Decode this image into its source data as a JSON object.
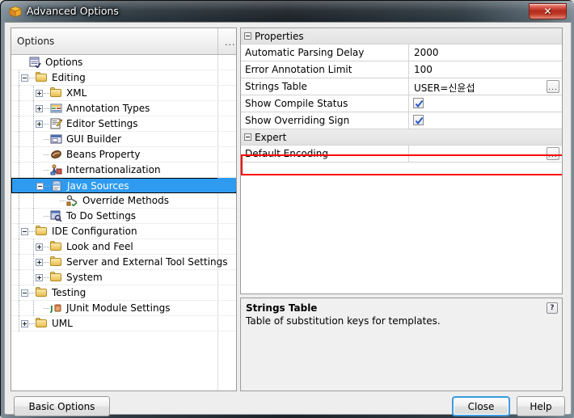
{
  "window": {
    "title": "Advanced Options",
    "icon": "netbeans-cube-icon",
    "close_label": "✕"
  },
  "tree": {
    "header_label": "Options",
    "header_more": "...",
    "items": [
      {
        "label": "Options",
        "depth": 0,
        "icon": "options-list-icon",
        "expander": "none"
      },
      {
        "label": "Editing",
        "depth": 1,
        "icon": "folder-icon",
        "expander": "minus"
      },
      {
        "label": "XML",
        "depth": 2,
        "icon": "folder-icon",
        "expander": "plus"
      },
      {
        "label": "Annotation Types",
        "depth": 2,
        "icon": "annotation-types-icon",
        "expander": "plus"
      },
      {
        "label": "Editor Settings",
        "depth": 2,
        "icon": "editor-settings-icon",
        "expander": "plus"
      },
      {
        "label": "GUI Builder",
        "depth": 2,
        "icon": "gui-builder-icon",
        "expander": "none"
      },
      {
        "label": "Beans Property",
        "depth": 2,
        "icon": "beans-property-icon",
        "expander": "none"
      },
      {
        "label": "Internationalization",
        "depth": 2,
        "icon": "i18n-icon",
        "expander": "none"
      },
      {
        "label": "Java Sources",
        "depth": 2,
        "icon": "java-sources-icon",
        "expander": "minus",
        "selected": true
      },
      {
        "label": "Override Methods",
        "depth": 3,
        "icon": "override-methods-icon",
        "expander": "none"
      },
      {
        "label": "To Do Settings",
        "depth": 2,
        "icon": "todo-settings-icon",
        "expander": "none"
      },
      {
        "label": "IDE Configuration",
        "depth": 1,
        "icon": "folder-icon",
        "expander": "minus"
      },
      {
        "label": "Look and Feel",
        "depth": 2,
        "icon": "folder-icon",
        "expander": "plus"
      },
      {
        "label": "Server and External Tool Settings",
        "depth": 2,
        "icon": "folder-icon",
        "expander": "plus"
      },
      {
        "label": "System",
        "depth": 2,
        "icon": "folder-icon",
        "expander": "plus"
      },
      {
        "label": "Testing",
        "depth": 1,
        "icon": "folder-icon",
        "expander": "minus"
      },
      {
        "label": "JUnit Module Settings",
        "depth": 2,
        "icon": "junit-icon",
        "expander": "none"
      },
      {
        "label": "UML",
        "depth": 1,
        "icon": "folder-icon",
        "expander": "plus"
      }
    ]
  },
  "properties": {
    "groups": [
      {
        "label": "Properties",
        "expander": "minus",
        "rows": [
          {
            "name": "Automatic Parsing Delay",
            "value": "2000",
            "type": "text"
          },
          {
            "name": "Error Annotation Limit",
            "value": "100",
            "type": "text"
          },
          {
            "name": "Strings Table",
            "value": "USER=신윤섭",
            "type": "text",
            "ellipsis": true,
            "ellipsis_label": "..."
          },
          {
            "name": "Show Compile Status",
            "value": "",
            "type": "checkbox",
            "checked": true
          },
          {
            "name": "Show Overriding Sign",
            "value": "",
            "type": "checkbox",
            "checked": true
          }
        ]
      },
      {
        "label": "Expert",
        "expander": "minus",
        "rows": [
          {
            "name": "Default Encoding",
            "value": "",
            "type": "text",
            "ellipsis": true,
            "ellipsis_label": "...",
            "highlighted": true
          }
        ]
      }
    ]
  },
  "description": {
    "title": "Strings Table",
    "text": "Table of substitution keys for templates.",
    "help_icon": "?"
  },
  "buttons": {
    "basic_options": "Basic Options",
    "close": "Close",
    "help": "Help"
  },
  "colors": {
    "selection": "#2e9bf0",
    "highlight_box": "#ff0000",
    "default_button_focus": "#3c9ae0"
  }
}
